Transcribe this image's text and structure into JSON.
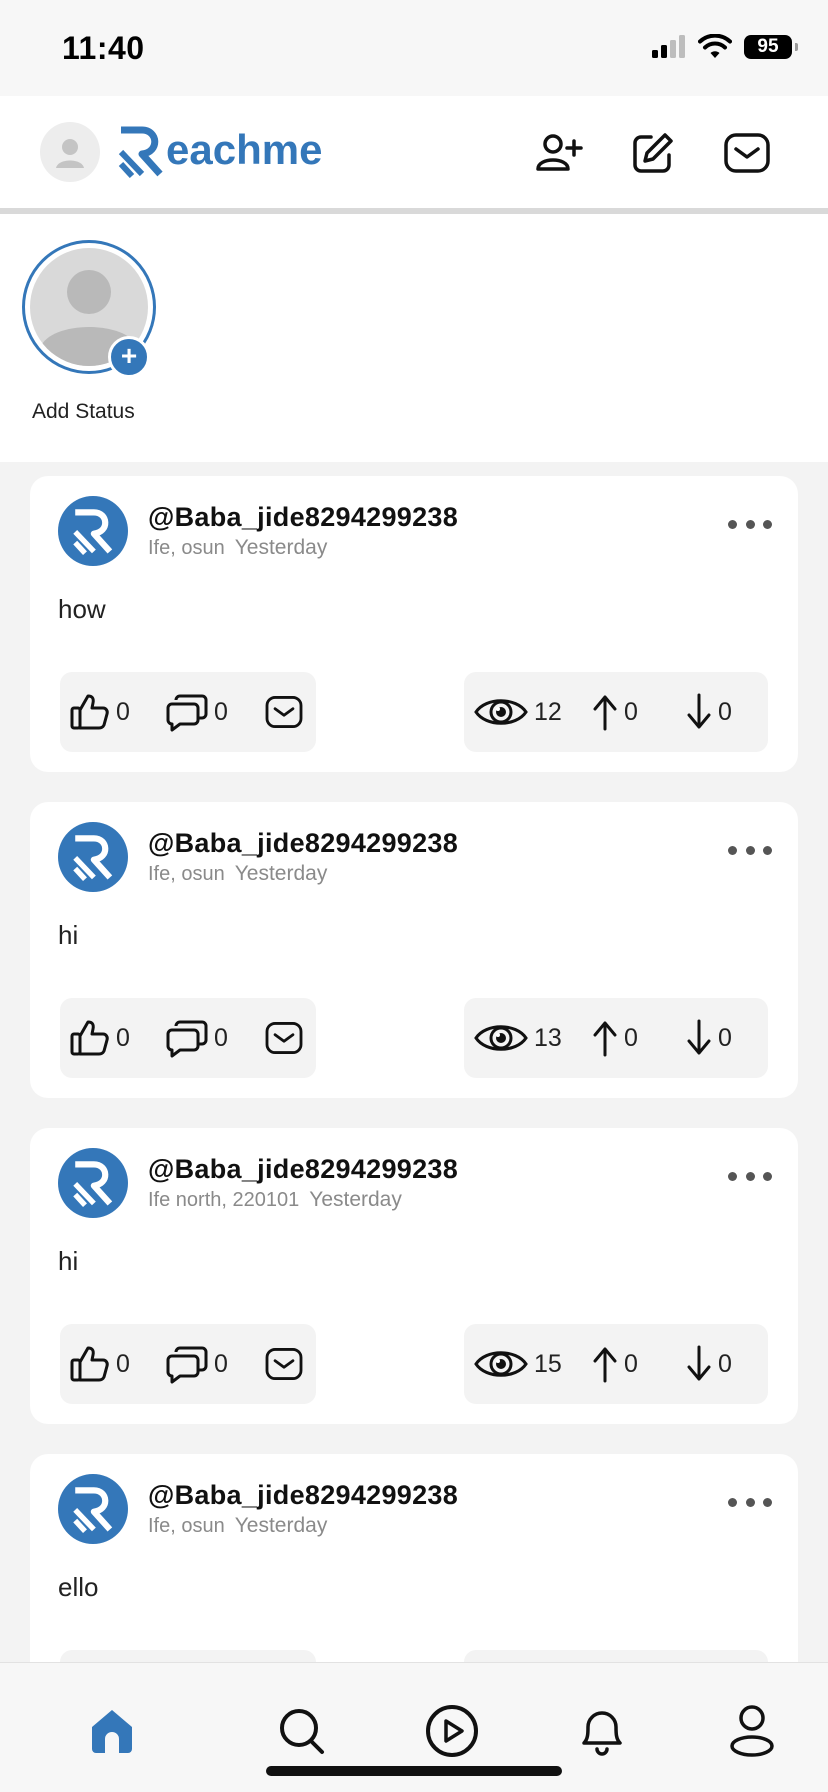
{
  "status_bar": {
    "time": "11:40",
    "battery": "95"
  },
  "header": {
    "logo_text": "eachme"
  },
  "status_section": {
    "add_status_label": "Add Status"
  },
  "posts": [
    {
      "username": "@Baba_jide8294299238",
      "location": "Ife, osun",
      "time": "Yesterday",
      "text": "how",
      "likes": "0",
      "comments": "0",
      "views": "12",
      "upvotes": "0",
      "downvotes": "0"
    },
    {
      "username": "@Baba_jide8294299238",
      "location": "Ife, osun",
      "time": "Yesterday",
      "text": "hi",
      "likes": "0",
      "comments": "0",
      "views": "13",
      "upvotes": "0",
      "downvotes": "0"
    },
    {
      "username": "@Baba_jide8294299238",
      "location": "Ife north, 220101",
      "time": "Yesterday",
      "text": "hi",
      "likes": "0",
      "comments": "0",
      "views": "15",
      "upvotes": "0",
      "downvotes": "0"
    },
    {
      "username": "@Baba_jide8294299238",
      "location": "Ife, osun",
      "time": "Yesterday",
      "text": "ello"
    }
  ],
  "nav": {
    "active": "home",
    "items": [
      "home-icon",
      "search-icon",
      "play-icon",
      "bell-icon",
      "profile-icon"
    ]
  },
  "colors": {
    "accent": "#3477b9",
    "background": "#f3f3f3",
    "card": "#ffffff"
  }
}
